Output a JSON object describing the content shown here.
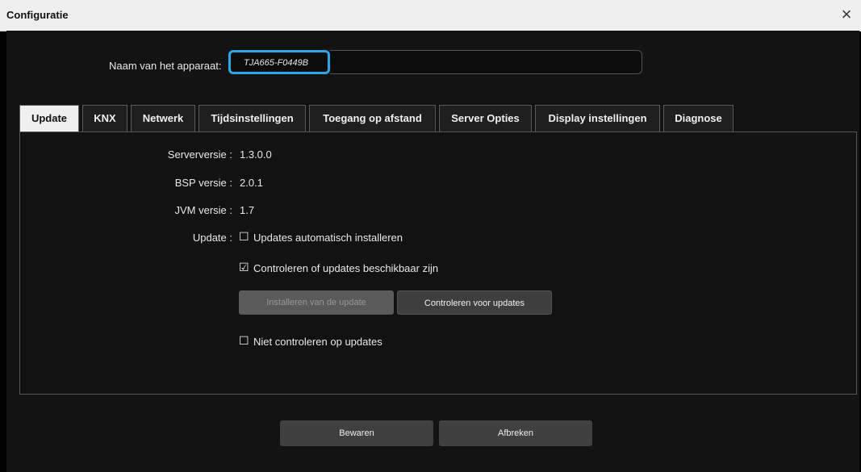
{
  "window": {
    "title": "Configuratie",
    "close_icon": "×"
  },
  "device": {
    "name_label": "Naam van het apparaat:",
    "name_value": "TJA665-F0449B"
  },
  "tabs": [
    {
      "label": "Update",
      "active": true
    },
    {
      "label": "KNX"
    },
    {
      "label": "Netwerk"
    },
    {
      "label": "Tijdsinstellingen"
    },
    {
      "label": "Toegang op afstand"
    },
    {
      "label": "Server Opties"
    },
    {
      "label": "Display instellingen"
    },
    {
      "label": "Diagnose"
    }
  ],
  "update": {
    "server_label": "Serverversie :",
    "server_value": "1.3.0.0",
    "bsp_label": "BSP versie :",
    "bsp_value": "2.0.1",
    "jvm_label": "JVM versie :",
    "jvm_value": "1.7",
    "update_label": "Update :",
    "auto_install": {
      "label": "Updates automatisch installeren",
      "checked": false
    },
    "check_available": {
      "label": "Controleren of updates beschikbaar zijn",
      "checked": true
    },
    "install_button": "Installeren van de update",
    "check_button": "Controleren voor updates",
    "no_check": {
      "label": "Niet controleren op updates",
      "checked": false
    }
  },
  "footer": {
    "save_label": "Bewaren",
    "cancel_label": "Afbreken"
  }
}
